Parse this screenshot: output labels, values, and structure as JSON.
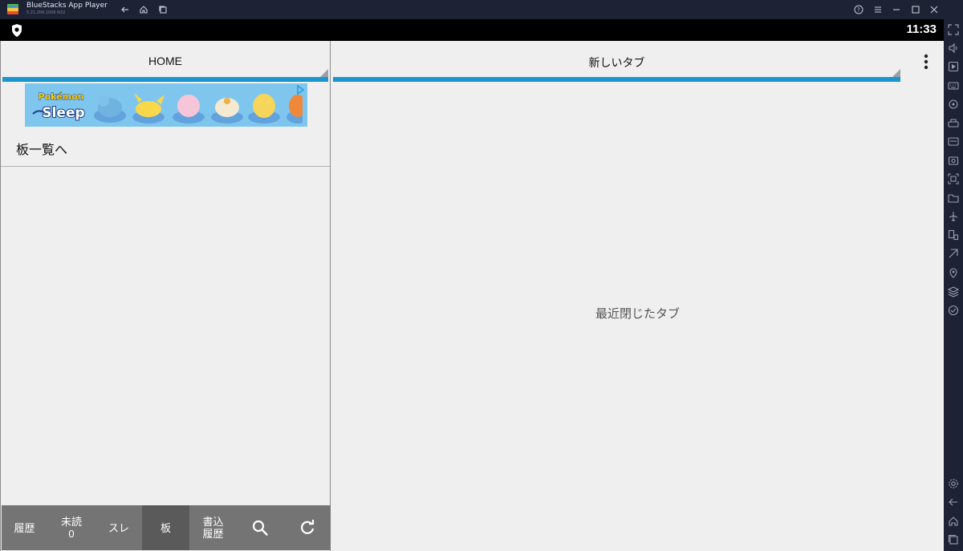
{
  "window": {
    "title": "BlueStacks App Player",
    "version": "5.21.206.1006 N32"
  },
  "statusbar": {
    "time": "11:33"
  },
  "left_tab": {
    "label": "HOME"
  },
  "right_tab": {
    "label": "新しいタブ"
  },
  "banner": {
    "logo_text_top": "Pokémon",
    "logo_text_bottom": "Sleep"
  },
  "board_link": "板一覧へ",
  "right_empty_label": "最近閉じたタブ",
  "bottom_nav": {
    "history": "履歴",
    "unread_line1": "未読",
    "unread_line2": "0",
    "thread": "スレ",
    "board": "板",
    "posts_line1": "書込",
    "posts_line2": "履歴"
  },
  "colors": {
    "accent": "#1a95cf",
    "bottom_nav": "#747474",
    "bottom_nav_active": "#5a5a5a",
    "chrome": "#1e2235"
  }
}
